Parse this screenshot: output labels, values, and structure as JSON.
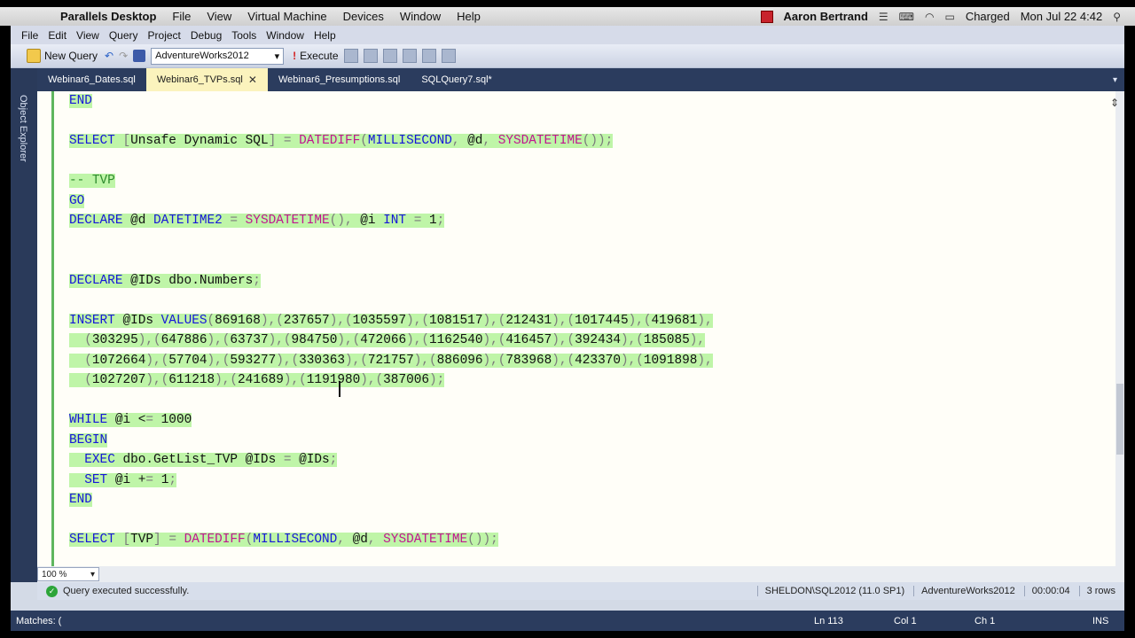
{
  "mac_menu": {
    "apple": "",
    "app_name": "Parallels Desktop",
    "items": [
      "File",
      "View",
      "Virtual Machine",
      "Devices",
      "Window",
      "Help"
    ],
    "user": "Aaron Bertrand",
    "battery": "Charged",
    "datetime": "Mon Jul 22  4:42"
  },
  "ssms_menu": [
    "File",
    "Edit",
    "View",
    "Query",
    "Project",
    "Debug",
    "Tools",
    "Window",
    "Help"
  ],
  "toolbar": {
    "new_query": "New Query",
    "database": "AdventureWorks2012",
    "execute": "Execute"
  },
  "left_rail": {
    "label": "Object Explorer"
  },
  "tabs": [
    {
      "label": "Webinar6_Dates.sql",
      "active": false
    },
    {
      "label": "Webinar6_TVPs.sql",
      "active": true
    },
    {
      "label": "Webinar6_Presumptions.sql",
      "active": false
    },
    {
      "label": "SQLQuery7.sql*",
      "active": false
    }
  ],
  "code_lines": [
    "END",
    "",
    "SELECT [Unsafe Dynamic SQL] = DATEDIFF(MILLISECOND, @d, SYSDATETIME());",
    "",
    "-- TVP",
    "GO",
    "DECLARE @d DATETIME2 = SYSDATETIME(), @i INT = 1;",
    "",
    "",
    "DECLARE @IDs dbo.Numbers;",
    "",
    "INSERT @IDs VALUES(869168),(237657),(1035597),(1081517),(212431),(1017445),(419681),",
    "  (303295),(647886),(63737),(984750),(472066),(1162540),(416457),(392434),(185085),",
    "  (1072664),(57704),(593277),(330363),(721757),(886096),(783968),(423370),(1091898),",
    "  (1027207),(611218),(241689),(1191980),(387006);",
    "",
    "WHILE @i <= 1000",
    "BEGIN",
    "  EXEC dbo.GetList_TVP @IDs = @IDs;",
    "  SET @i += 1;",
    "END",
    "",
    "SELECT [TVP] = DATEDIFF(MILLISECOND, @d, SYSDATETIME());"
  ],
  "zoom": "100 %",
  "status": {
    "message": "Query executed successfully.",
    "server": "SHELDON\\SQL2012 (11.0 SP1)",
    "database": "AdventureWorks2012",
    "elapsed": "00:00:04",
    "rows": "3 rows"
  },
  "bottom": {
    "matches": "Matches: (",
    "line": "Ln 113",
    "col": "Col 1",
    "ch": "Ch 1",
    "mode": "INS"
  },
  "colors": {
    "selection": "#bff5a8",
    "keyword": "#1616d9",
    "function": "#c0168f",
    "tab_active": "#fbf3bd"
  }
}
